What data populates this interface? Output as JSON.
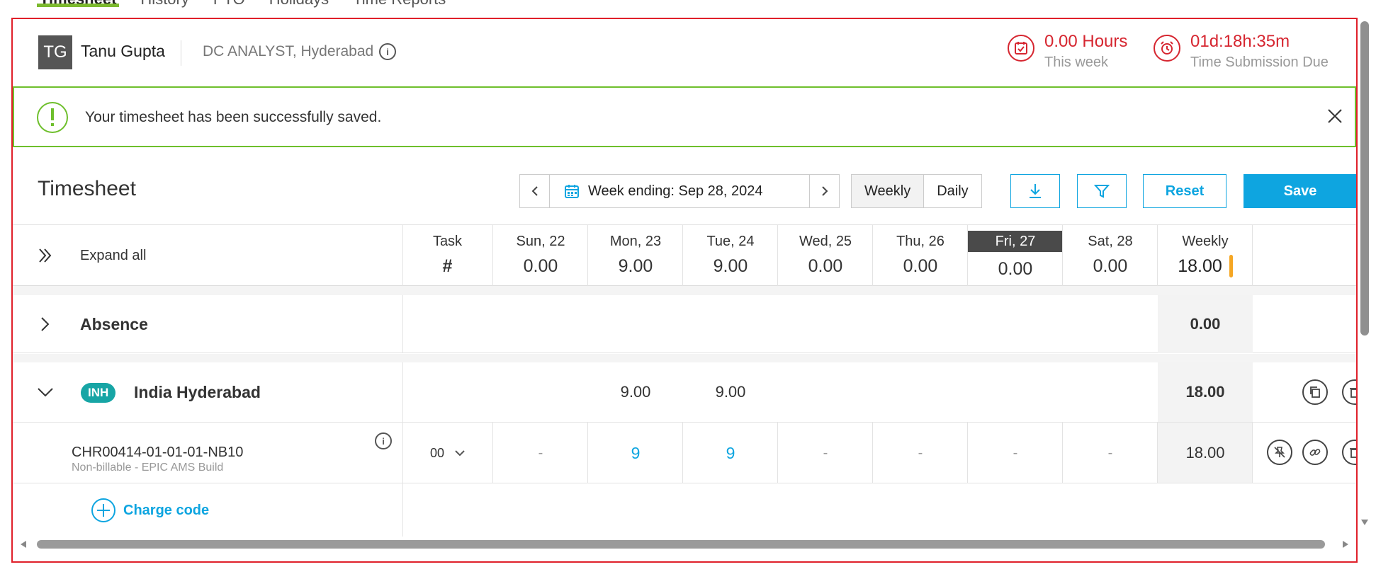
{
  "nav": {
    "tabs": [
      "Timesheet",
      "History",
      "PTO",
      "Holidays",
      "Time Reports"
    ]
  },
  "user": {
    "initials": "TG",
    "name": "Tanu Gupta",
    "role": "DC ANALYST, Hyderabad"
  },
  "stats": {
    "hours_value": "0.00 Hours",
    "hours_label": "This week",
    "due_value": "01d:18h:35m",
    "due_label": "Time Submission Due"
  },
  "banner": {
    "message": "Your timesheet has been successfully saved."
  },
  "toolbar": {
    "title": "Timesheet",
    "week_label": "Week ending: Sep 28, 2024",
    "weekly": "Weekly",
    "daily": "Daily",
    "reset": "Reset",
    "save": "Save"
  },
  "grid": {
    "expand_all": "Expand all",
    "task_header": "Task",
    "task_hash": "#",
    "days": [
      "Sun, 22",
      "Mon, 23",
      "Tue, 24",
      "Wed, 25",
      "Thu, 26",
      "Fri, 27",
      "Sat, 28"
    ],
    "day_totals": [
      "0.00",
      "9.00",
      "9.00",
      "0.00",
      "0.00",
      "0.00",
      "0.00"
    ],
    "weekly_header": "Weekly",
    "weekly_total": "18.00",
    "absence": {
      "label": "Absence",
      "total": "0.00"
    },
    "group": {
      "badge": "INH",
      "name": "India Hyderabad",
      "mon": "9.00",
      "tue": "9.00",
      "total": "18.00"
    },
    "task": {
      "code": "CHR00414-01-01-01-NB10",
      "desc": "Non-billable - EPIC AMS Build",
      "task_no": "00",
      "hours": [
        "-",
        "9",
        "9",
        "-",
        "-",
        "-",
        "-"
      ],
      "total": "18.00"
    },
    "add_charge": "Charge code"
  },
  "colors": {
    "accent": "#0ea5e0",
    "alert": "#d62630",
    "success": "#6ebf2c",
    "badge": "#17a5a5"
  }
}
